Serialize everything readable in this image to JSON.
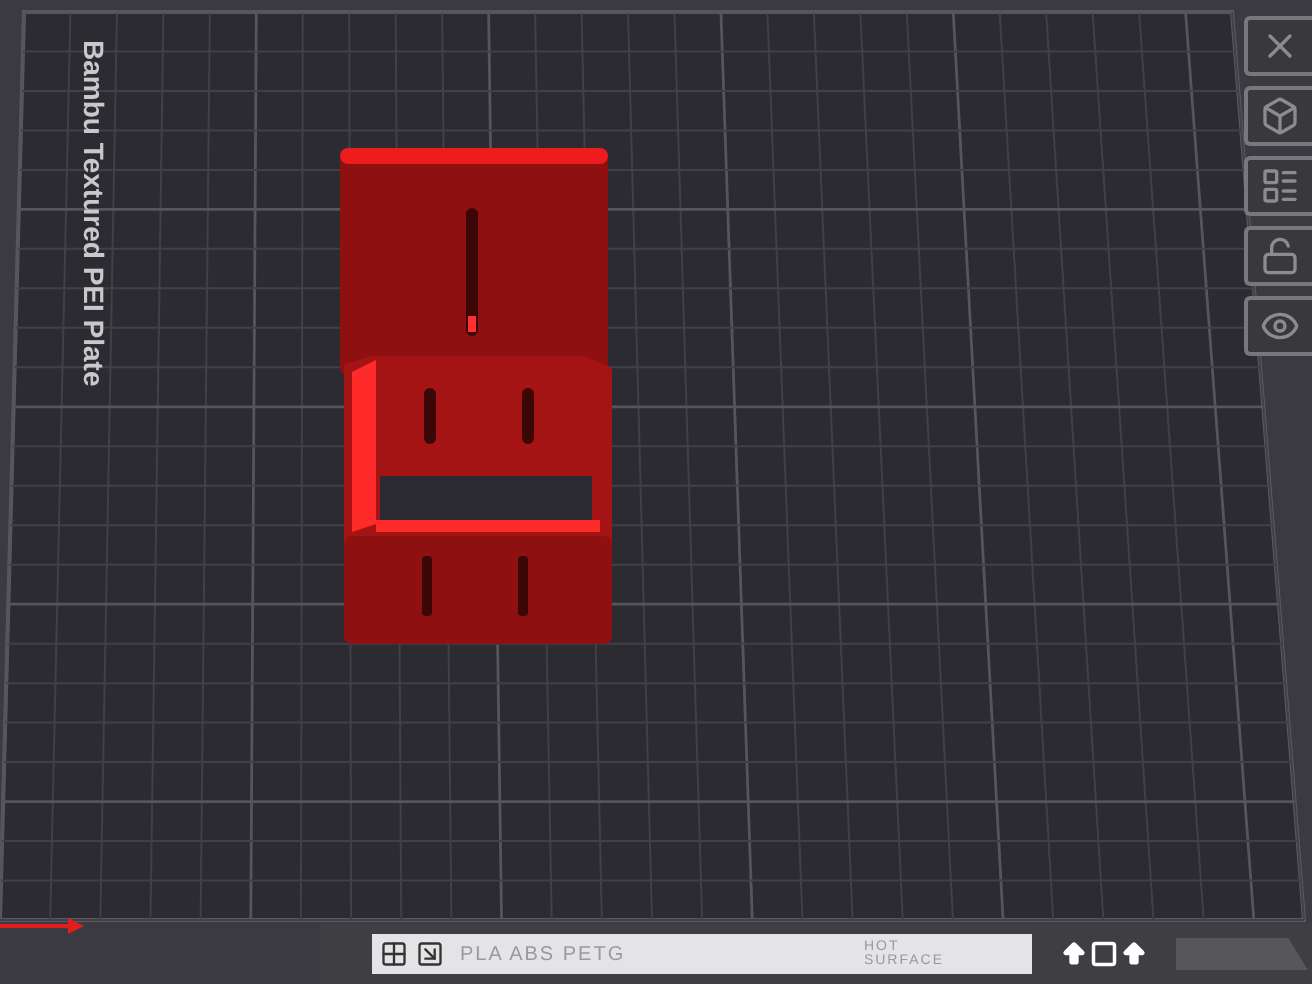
{
  "plate": {
    "label": "Bambu Textured PEI Plate"
  },
  "bottom_bar": {
    "filaments": "PLA ABS PETG",
    "warning": [
      "HOT",
      "SURFACE"
    ]
  }
}
